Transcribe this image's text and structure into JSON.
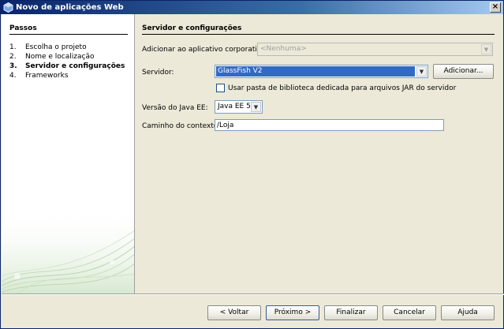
{
  "window": {
    "title": "Novo de aplicações Web",
    "close_label": "×"
  },
  "steps": {
    "title": "Passos",
    "items": [
      {
        "num": "1.",
        "label": "Escolha o projeto"
      },
      {
        "num": "2.",
        "label": "Nome e localização"
      },
      {
        "num": "3.",
        "label": "Servidor e configurações",
        "current": true
      },
      {
        "num": "4.",
        "label": "Frameworks"
      }
    ]
  },
  "main": {
    "section_title": "Servidor e configurações",
    "enterprise_app": {
      "label": "Adicionar ao aplicativo corporativo:",
      "value": "<Nenhuma>"
    },
    "server": {
      "label": "Servidor:",
      "value": "GlassFish V2",
      "add_button": "Adicionar..."
    },
    "library_checkbox": {
      "label": "Usar pasta de biblioteca dedicada para arquivos JAR do servidor",
      "checked": false
    },
    "java_ee": {
      "label": "Versão do Java EE:",
      "value": "Java EE 5"
    },
    "context_path": {
      "label": "Caminho do contexto:",
      "value": "/Loja"
    }
  },
  "buttons": {
    "back": "< Voltar",
    "next": "Próximo >",
    "finish": "Finalizar",
    "cancel": "Cancelar",
    "help": "Ajuda"
  },
  "icons": {
    "title_icon": "netbeans-cube-icon",
    "dropdown_arrow": "▼"
  }
}
